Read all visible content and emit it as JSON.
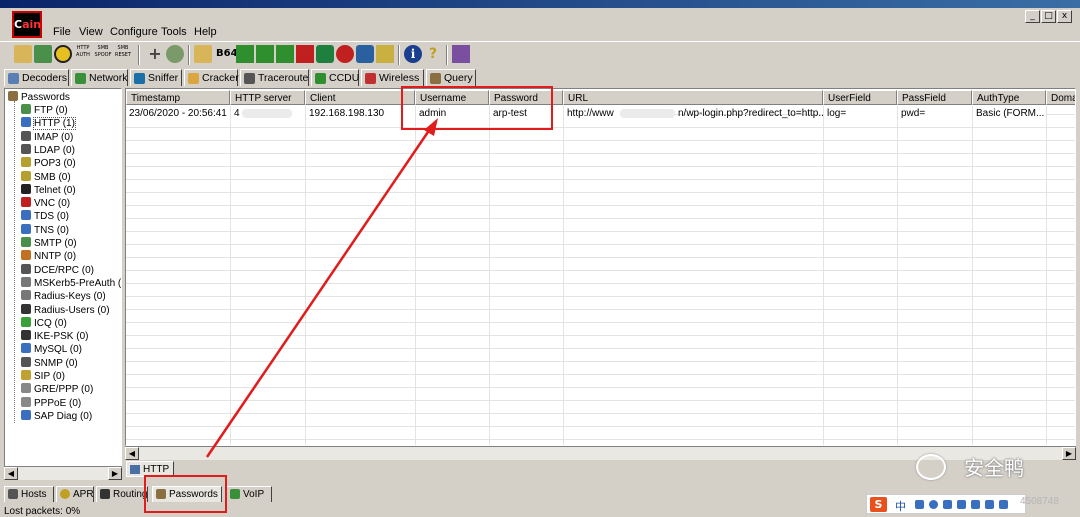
{
  "window": {
    "logo_text": "ain",
    "buttons": [
      "_",
      "□",
      "x"
    ]
  },
  "menu": [
    "File",
    "View",
    "Configure",
    "Tools",
    "Help"
  ],
  "toolbar": {
    "icons": [
      "open-icon",
      "plug-icon",
      "radiation-icon",
      "http-auth-icon",
      "smb-spoof-icon",
      "smb-spoof-reset-icon",
      "add-icon",
      "cleanup-icon",
      "decoder-icon",
      "base64-icon",
      "lsa-icon",
      "hash-icon",
      "vnc-icon",
      "cisco-icon",
      "dial-icon",
      "record-icon",
      "wireless-icon",
      "info-icon",
      "help-icon",
      "exit-icon"
    ],
    "labels": [
      "HTTP AUTH",
      "SMB SPOOF",
      "SMB RESET",
      "B64"
    ]
  },
  "tabs": [
    {
      "label": "Decoders",
      "color": "#5a7fb5"
    },
    {
      "label": "Network",
      "color": "#3a8f3a"
    },
    {
      "label": "Sniffer",
      "color": "#1b6fa8"
    },
    {
      "label": "Cracker",
      "color": "#d9a640"
    },
    {
      "label": "Traceroute",
      "color": "#555555"
    },
    {
      "label": "CCDU",
      "color": "#2f8f2f"
    },
    {
      "label": "Wireless",
      "color": "#c03030"
    },
    {
      "label": "Query",
      "color": "#8a6f40"
    }
  ],
  "tree": {
    "root": "Passwords",
    "items": [
      {
        "label": "FTP (0)",
        "color": "#4a8f4a"
      },
      {
        "label": "HTTP (1)",
        "color": "#3a6fc0"
      },
      {
        "label": "IMAP (0)",
        "color": "#555555"
      },
      {
        "label": "LDAP (0)",
        "color": "#555555"
      },
      {
        "label": "POP3 (0)",
        "color": "#b5a030"
      },
      {
        "label": "SMB (0)",
        "color": "#b5a030"
      },
      {
        "label": "Telnet (0)",
        "color": "#222222"
      },
      {
        "label": "VNC (0)",
        "color": "#c02020"
      },
      {
        "label": "TDS (0)",
        "color": "#3a6fc0"
      },
      {
        "label": "TNS (0)",
        "color": "#3a6fc0"
      },
      {
        "label": "SMTP (0)",
        "color": "#4a8f4a"
      },
      {
        "label": "NNTP (0)",
        "color": "#c07020"
      },
      {
        "label": "DCE/RPC (0)",
        "color": "#555555"
      },
      {
        "label": "MSKerb5-PreAuth (",
        "color": "#777777"
      },
      {
        "label": "Radius-Keys (0)",
        "color": "#777777"
      },
      {
        "label": "Radius-Users (0)",
        "color": "#333333"
      },
      {
        "label": "ICQ (0)",
        "color": "#3aa03a"
      },
      {
        "label": "IKE-PSK (0)",
        "color": "#333333"
      },
      {
        "label": "MySQL (0)",
        "color": "#3a6fc0"
      },
      {
        "label": "SNMP (0)",
        "color": "#555555"
      },
      {
        "label": "SIP (0)",
        "color": "#c0a030"
      },
      {
        "label": "GRE/PPP (0)",
        "color": "#888888"
      },
      {
        "label": "PPPoE (0)",
        "color": "#888888"
      },
      {
        "label": "SAP Diag (0)",
        "color": "#3a6fc0"
      }
    ]
  },
  "grid": {
    "columns": [
      "Timestamp",
      "HTTP server",
      "Client",
      "Username",
      "Password",
      "URL",
      "UserField",
      "PassField",
      "AuthType",
      "Doma"
    ],
    "rows": [
      [
        "23/06/2020 - 20:56:41",
        "4",
        "192.168.198.130",
        "admin",
        "arp-test",
        "http://www",
        "n/wp-login.php?redirect_to=http...",
        "log=",
        "pwd=",
        "Basic (FORM..."
      ]
    ]
  },
  "subtab": "HTTP",
  "bottom_tabs": [
    {
      "label": "Hosts",
      "color": "#555555"
    },
    {
      "label": "APR",
      "color": "#c0a020"
    },
    {
      "label": "Routing",
      "color": "#333333"
    },
    {
      "label": "Passwords",
      "color": "#8a6f40"
    },
    {
      "label": "VoIP",
      "color": "#3a8f3a"
    }
  ],
  "status": "Lost packets:   0%",
  "tray": {
    "logo": "S",
    "text": "中"
  },
  "watermark": {
    "text": "安全鸭",
    "id": "4508748"
  }
}
